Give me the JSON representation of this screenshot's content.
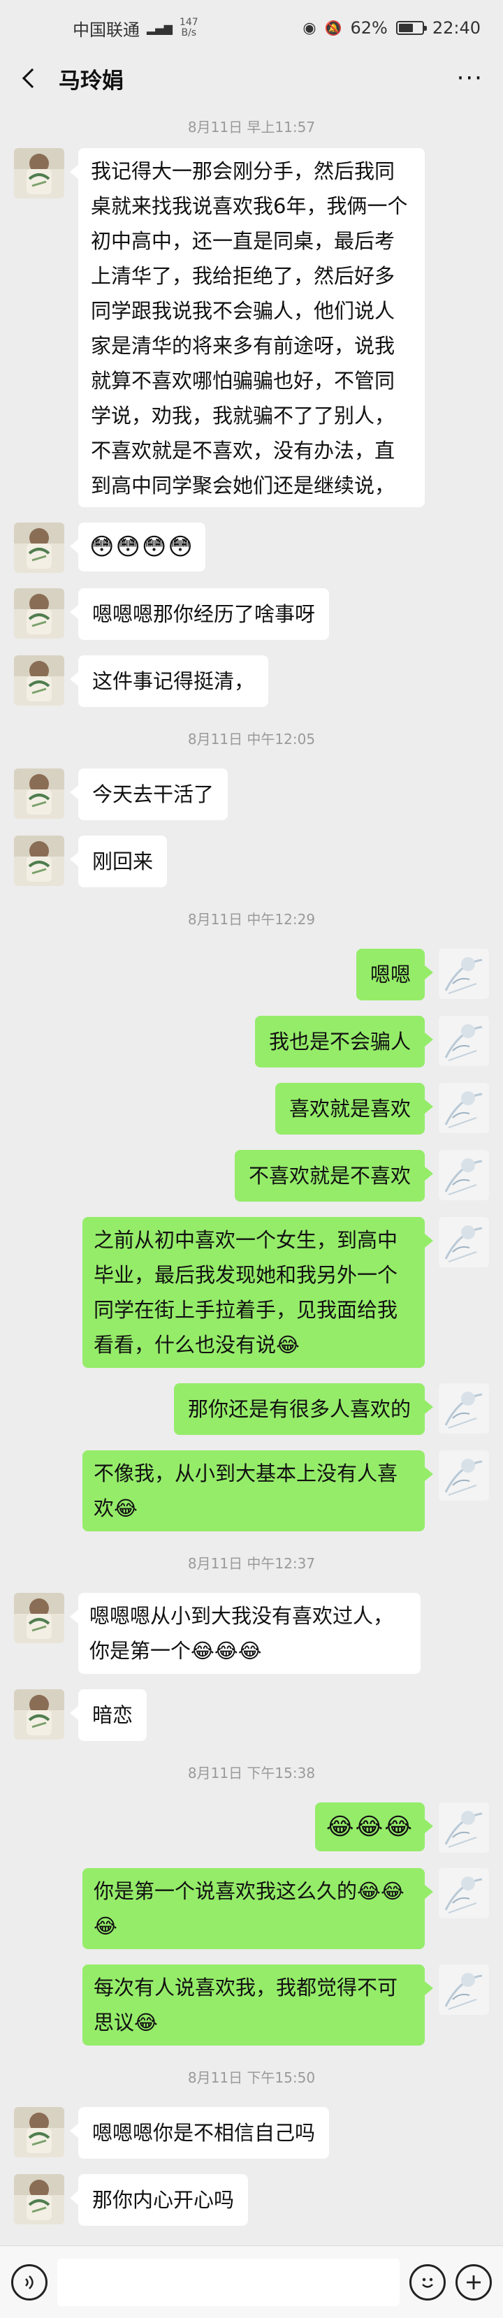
{
  "status_bar": {
    "carrier": "中国联通",
    "speed_value": "147",
    "speed_unit": "B/s",
    "battery": "62%",
    "battery_level": 0.62,
    "time": "22:40"
  },
  "header": {
    "title": "马玲娟",
    "more": "···"
  },
  "timestamps": {
    "t1": "8月11日 早上11:57",
    "t2": "8月11日 中午12:05",
    "t3": "8月11日 中午12:29",
    "t4": "8月11日 中午12:37",
    "t5": "8月11日 下午15:38",
    "t6": "8月11日 下午15:50"
  },
  "messages": {
    "m1": "我记得大一那会刚分手，然后我同桌就来找我说喜欢我6年，我俩一个初中高中，还一直是同桌，最后考上清华了，我给拒绝了，然后好多同学跟我说我不会骗人，他们说人家是清华的将来多有前途呀，说我就算不喜欢哪怕骗骗也好，不管同学说，劝我，我就骗不了了别人，不喜欢就是不喜欢，没有办法，直到高中同学聚会她们还是继续说，",
    "m2": "😳😳😳😳",
    "m3": "嗯嗯嗯那你经历了啥事呀",
    "m4": "这件事记得挺清，",
    "m5": "今天去干活了",
    "m6": "刚回来",
    "m7": "嗯嗯",
    "m8": "我也是不会骗人",
    "m9": "喜欢就是喜欢",
    "m10": "不喜欢就是不喜欢",
    "m11": "之前从初中喜欢一个女生，到高中毕业，最后我发现她和我另外一个同学在街上手拉着手，见我面给我看看，什么也没有说😂",
    "m12": "那你还是有很多人喜欢的",
    "m13": "不像我，从小到大基本上没有人喜欢😂",
    "m14": "嗯嗯嗯从小到大我没有喜欢过人，你是第一个😂😂😂",
    "m15": "暗恋",
    "m16": "😂😂😂",
    "m17": "你是第一个说喜欢我这么久的😂😂😂",
    "m18": "每次有人说喜欢我，我都觉得不可思议😂",
    "m19": "嗯嗯嗯你是不相信自己吗",
    "m20": "那你内心开心吗"
  },
  "input_bar": {
    "voice_icon": "voice-icon",
    "emoji_icon": "emoji-icon",
    "plus_icon": "plus-icon"
  },
  "colors": {
    "background": "#ededed",
    "bubble_self": "#95ec69",
    "bubble_other": "#ffffff"
  }
}
